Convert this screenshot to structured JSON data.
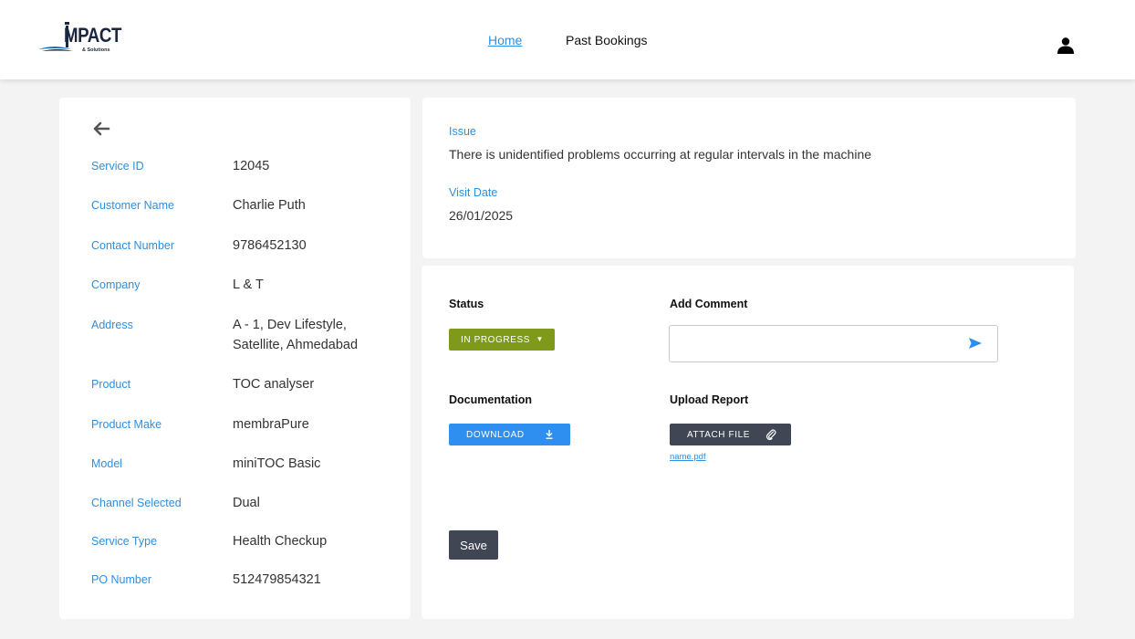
{
  "header": {
    "logo_text": "MPACT",
    "logo_tagline": "& Solutions",
    "nav": {
      "home": "Home",
      "past_bookings": "Past Bookings"
    },
    "user_icon": "user-icon"
  },
  "details": {
    "back_icon": "arrow-left-icon",
    "service_id": {
      "label": "Service ID",
      "value": "12045"
    },
    "customer_name": {
      "label": "Customer Name",
      "value": "Charlie Puth"
    },
    "contact_number": {
      "label": "Contact Number",
      "value": "9786452130"
    },
    "company": {
      "label": "Company",
      "value": "L & T"
    },
    "address": {
      "label": "Address",
      "value_line1": "A - 1, Dev Lifestyle,",
      "value_line2": "Satellite, Ahmedabad"
    },
    "product": {
      "label": "Product",
      "value": "TOC analyser"
    },
    "product_make": {
      "label": "Product Make",
      "value": "membraPure"
    },
    "model": {
      "label": "Model",
      "value": "miniTOC Basic"
    },
    "channel_selected": {
      "label": "Channel Selected",
      "value": "Dual"
    },
    "service_type": {
      "label": "Service Type",
      "value": "Health Checkup"
    },
    "po_number": {
      "label": "PO Number",
      "value": "512479854321"
    }
  },
  "issue": {
    "label": "Issue",
    "text": "There is unidentified problems occurring at regular intervals in the machine",
    "visit_date_label": "Visit Date",
    "visit_date": "26/01/2025"
  },
  "actions": {
    "status_title": "Status",
    "status_value": "IN PROGRESS",
    "status_color": "#7f9a1b",
    "comment_title": "Add Comment",
    "comment_value": "",
    "documentation_title": "Documentation",
    "download_label": "DOWNLOAD",
    "download_color": "#2e8ff0",
    "upload_title": "Upload Report",
    "attach_label": "ATTACH FILE",
    "attached_file": "name.pdf",
    "save_label": "Save"
  },
  "colors": {
    "accent": "#2f8fe0",
    "dark_button": "#414655",
    "background": "#f3f3f3"
  }
}
